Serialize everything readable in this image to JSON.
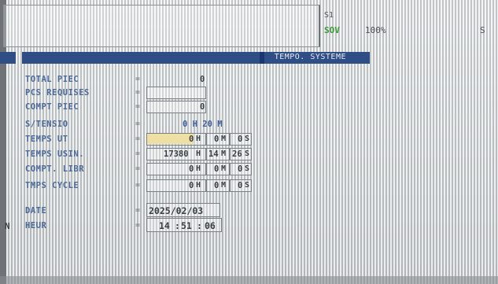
{
  "status": {
    "label": "S1",
    "value": "SOV",
    "percent": "100%",
    "right": "S"
  },
  "title": "TEMPO. SYSTEME",
  "rows": [
    {
      "label": "TOTAL PIEC",
      "value": "0"
    },
    {
      "label": "PCS REQUISES",
      "value": ""
    },
    {
      "label": "COMPT PIEC",
      "value": "0"
    },
    {
      "label": "S/TENSIO",
      "value": "0 H 20 M"
    },
    {
      "label": "TEMPS UT",
      "h": "0",
      "m": "0",
      "s": "0"
    },
    {
      "label": "TEMPS USIN.",
      "h": "17380",
      "m": "14",
      "s": "26"
    },
    {
      "label": "COMPT. LIBR",
      "h": "0",
      "m": "0",
      "s": "0"
    },
    {
      "label": "TMPS CYCLE",
      "h": "0",
      "m": "0",
      "s": "0"
    }
  ],
  "date": {
    "label": "DATE",
    "value": "2025/02/03"
  },
  "heure": {
    "label": "HEUR",
    "h": "14",
    "m": "51",
    "s": "06",
    "prefix": "N"
  },
  "units": {
    "h": "H",
    "m": "M",
    "s": "S"
  }
}
